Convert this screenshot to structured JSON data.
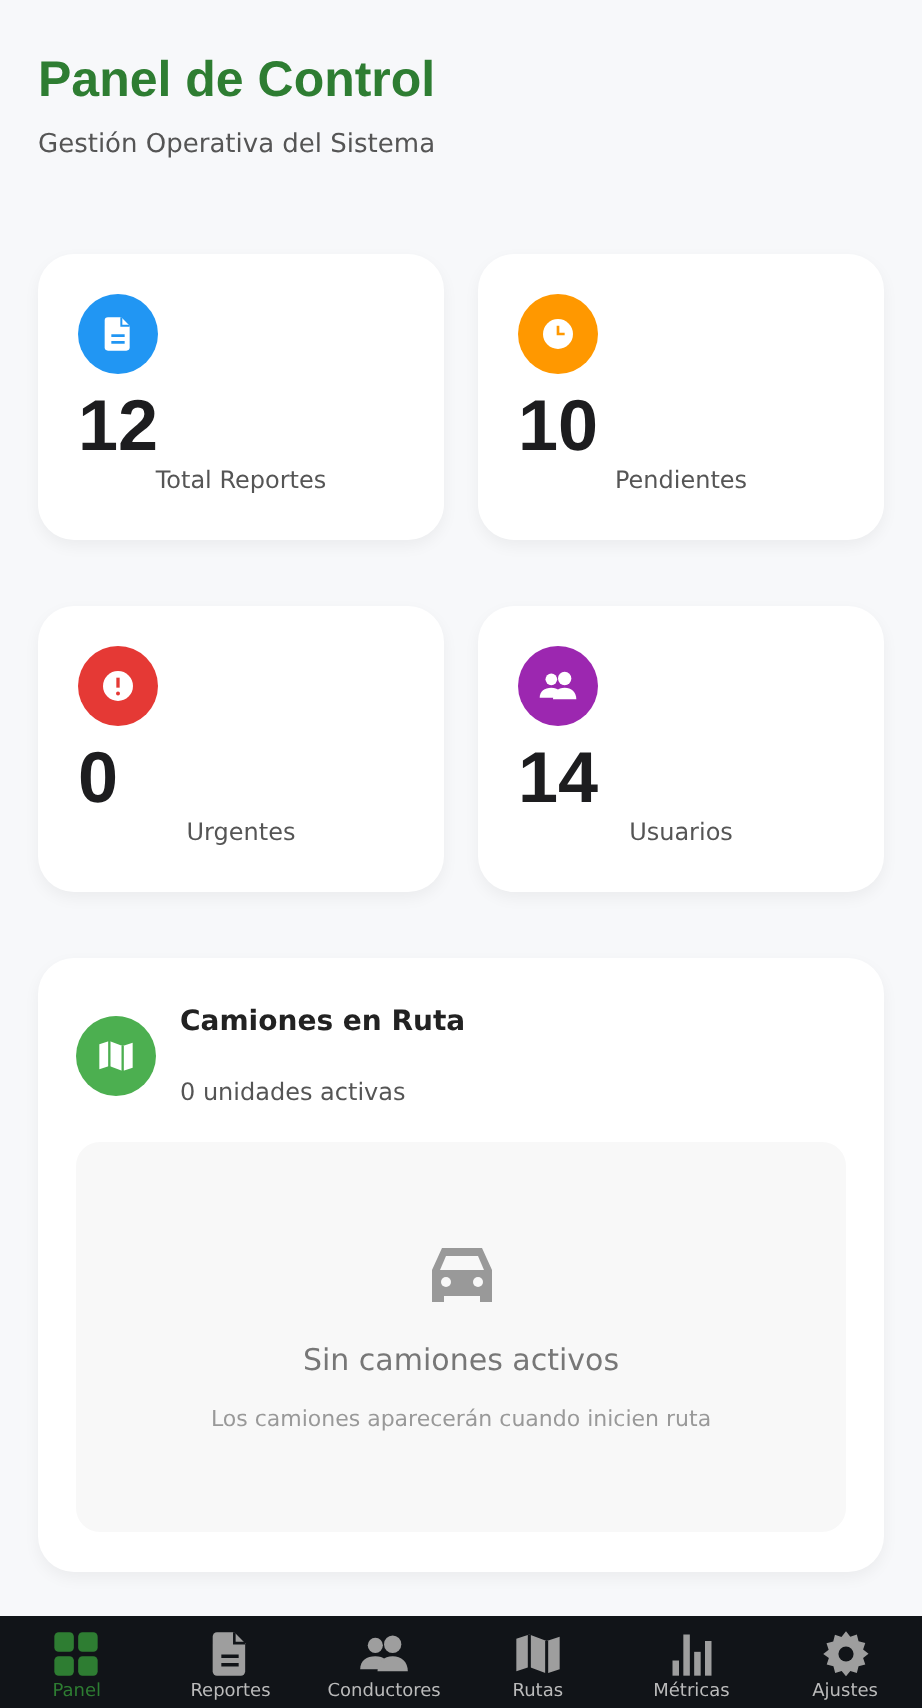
{
  "header": {
    "title": "Panel de Control",
    "subtitle": "Gestión Operativa del Sistema"
  },
  "stats": [
    {
      "kind": "document",
      "color": "#2196f3",
      "value": "12",
      "label": "Total Reportes"
    },
    {
      "kind": "clock",
      "color": "#ff9800",
      "value": "10",
      "label": "Pendientes"
    },
    {
      "kind": "alert",
      "color": "#e53935",
      "value": "0",
      "label": "Urgentes"
    },
    {
      "kind": "users",
      "color": "#9c27b0",
      "value": "14",
      "label": "Usuarios"
    }
  ],
  "trucks_panel": {
    "title": "Camiones en Ruta",
    "subtitle": "0 unidades activas",
    "empty_title": "Sin camiones activos",
    "empty_text": "Los camiones aparecerán cuando inicien ruta"
  },
  "bottom_nav": [
    {
      "kind": "grid",
      "label": "Panel",
      "selected": true
    },
    {
      "kind": "document",
      "label": "Reportes",
      "selected": false
    },
    {
      "kind": "users",
      "label": "Conductores",
      "selected": false
    },
    {
      "kind": "map",
      "label": "Rutas",
      "selected": false
    },
    {
      "kind": "chart",
      "label": "Métricas",
      "selected": false
    },
    {
      "kind": "gear",
      "label": "Ajustes",
      "selected": false
    }
  ]
}
